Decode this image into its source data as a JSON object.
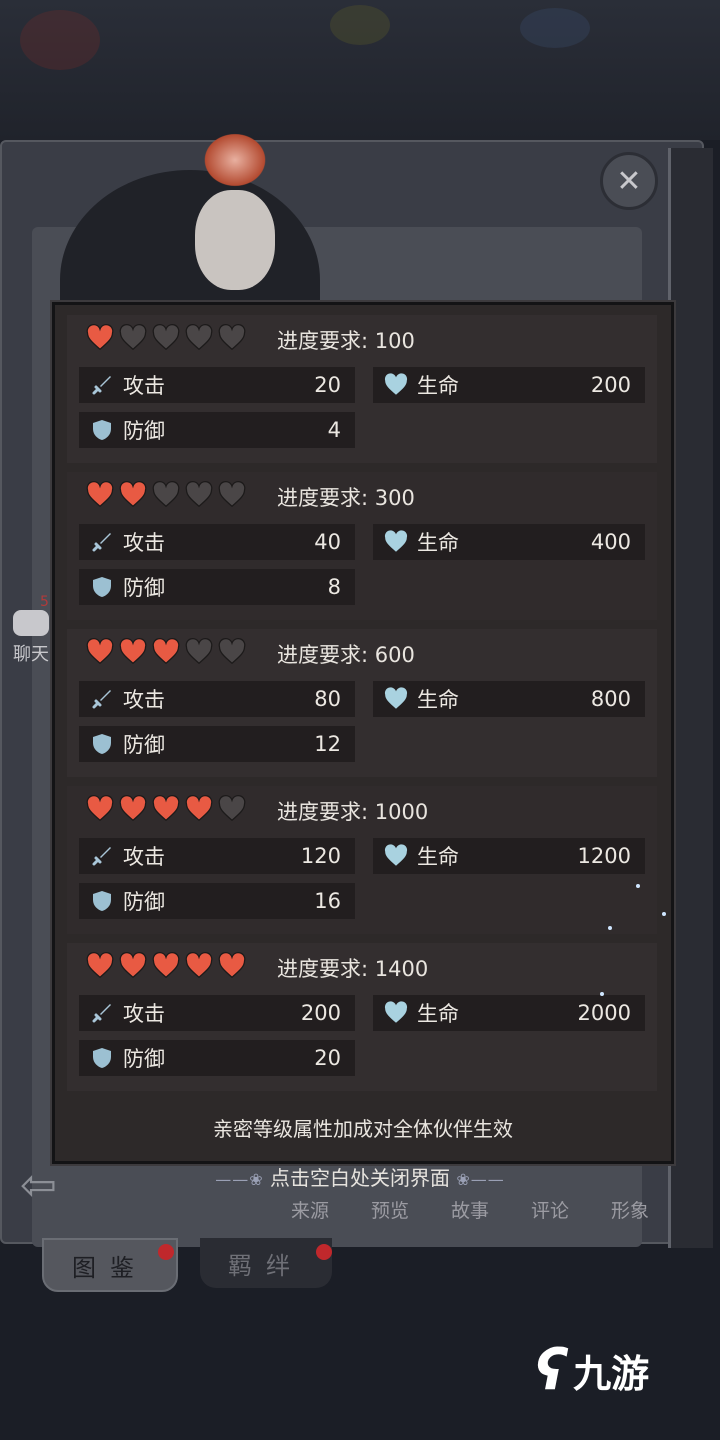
{
  "colors": {
    "heart_on": "#e85a43",
    "heart_off": "#4a4647",
    "attack_icon": "#a9c6d8",
    "hp_icon": "#a9d2e0",
    "defense_icon": "#9cc0d2",
    "panel_bg": "#2d2929"
  },
  "side": {
    "chat_label": "聊天",
    "chat_badge": "5"
  },
  "tiers": [
    {
      "hearts_filled": 1,
      "hearts_total": 5,
      "req_label": "进度要求:",
      "req_value": "100",
      "attack_label": "攻击",
      "attack": "20",
      "hp_label": "生命",
      "hp": "200",
      "defense_label": "防御",
      "defense": "4"
    },
    {
      "hearts_filled": 2,
      "hearts_total": 5,
      "req_label": "进度要求:",
      "req_value": "300",
      "attack_label": "攻击",
      "attack": "40",
      "hp_label": "生命",
      "hp": "400",
      "defense_label": "防御",
      "defense": "8"
    },
    {
      "hearts_filled": 3,
      "hearts_total": 5,
      "req_label": "进度要求:",
      "req_value": "600",
      "attack_label": "攻击",
      "attack": "80",
      "hp_label": "生命",
      "hp": "800",
      "defense_label": "防御",
      "defense": "12"
    },
    {
      "hearts_filled": 4,
      "hearts_total": 5,
      "req_label": "进度要求:",
      "req_value": "1000",
      "attack_label": "攻击",
      "attack": "120",
      "hp_label": "生命",
      "hp": "1200",
      "defense_label": "防御",
      "defense": "16"
    },
    {
      "hearts_filled": 5,
      "hearts_total": 5,
      "req_label": "进度要求:",
      "req_value": "1400",
      "attack_label": "攻击",
      "attack": "200",
      "hp_label": "生命",
      "hp": "2000",
      "defense_label": "防御",
      "defense": "20"
    }
  ],
  "note": "亲密等级属性加成对全体伙伴生效",
  "tap_close": "点击空白处关闭界面",
  "bottom_tabs": [
    "来源",
    "预览",
    "故事",
    "评论",
    "形象"
  ],
  "book_tabs": [
    "图鉴",
    "羁绊"
  ],
  "watermark": "九游"
}
